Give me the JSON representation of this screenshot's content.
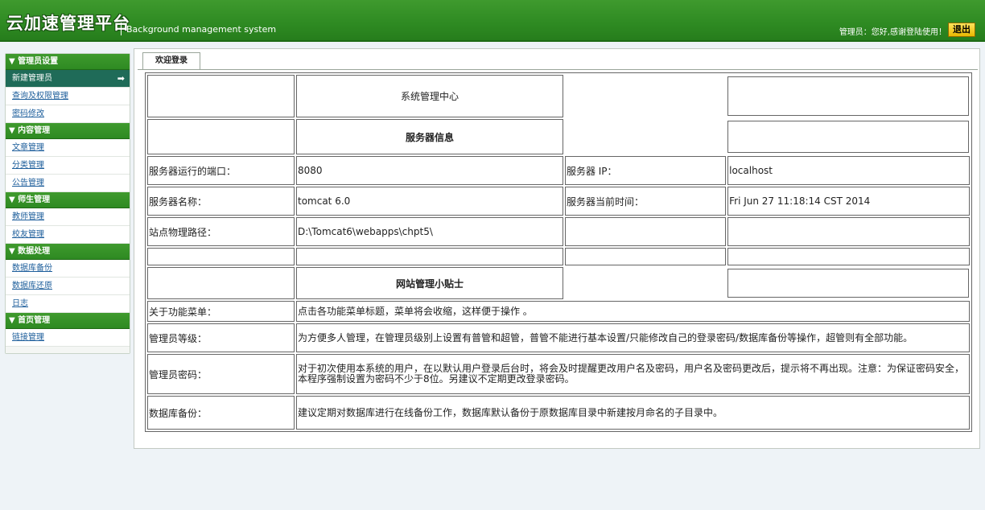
{
  "header": {
    "logo": "云加速管理平台",
    "subtitle": "Background management system",
    "greeting": "管理员：您好,感谢登陆使用！",
    "logout_label": "退出"
  },
  "sidebar": {
    "groups": [
      {
        "title": "▼ 管理员设置",
        "items": [
          "新建管理员",
          "查询及权限管理",
          "密码修改"
        ]
      },
      {
        "title": "▼ 内容管理",
        "items": [
          "文章管理",
          "分类管理",
          "公告管理"
        ]
      },
      {
        "title": "▼ 师生管理",
        "items": [
          "教师管理",
          "校友管理"
        ]
      },
      {
        "title": "▼ 数据处理",
        "items": [
          "数据库备份",
          "数据库还原",
          "日志"
        ]
      },
      {
        "title": "▼ 首页管理",
        "items": [
          "链接管理"
        ]
      }
    ],
    "active_arrow": "➡"
  },
  "main": {
    "tab_label": "欢迎登录",
    "table": {
      "title": "系统管理中心",
      "server_info_title": "服务器信息",
      "port_label": "服务器运行的端口：",
      "port_value": "8080",
      "ip_label": "服务器 IP：",
      "ip_value": "localhost",
      "name_label": "服务器名称：",
      "name_value": "tomcat 6.0",
      "time_label": "服务器当前时间：",
      "time_value": "Fri Jun 27 11:18:14 CST 2014",
      "path_label": "站点物理路径：",
      "path_value": "D:\\Tomcat6\\webapps\\chpt5\\",
      "tips_title": "网站管理小贴士",
      "tips": [
        {
          "label": "关于功能菜单：",
          "text": "点击各功能菜单标题，菜单将会收缩，这样便于操作 。"
        },
        {
          "label": "管理员等级：",
          "text": "为方便多人管理，在管理员级别上设置有普管和超管，普管不能进行基本设置/只能修改自己的登录密码/数据库备份等操作，超管则有全部功能。"
        },
        {
          "label": "管理员密码：",
          "text": "对于初次使用本系统的用户，在以默认用户登录后台时，将会及时提醒更改用户名及密码，用户名及密码更改后，提示将不再出现。注意：为保证密码安全，本程序强制设置为密码不少于8位。另建议不定期更改登录密码。"
        },
        {
          "label": "数据库备份：",
          "text": "建议定期对数据库进行在线备份工作，数据库默认备份于原数据库目录中新建按月命名的子目录中。"
        }
      ]
    }
  },
  "colors": {
    "header_green": "#2e8a22",
    "active_nav": "#1f6b58",
    "link_blue": "#1d5e9b",
    "logout_yellow": "#f5cd1a"
  }
}
